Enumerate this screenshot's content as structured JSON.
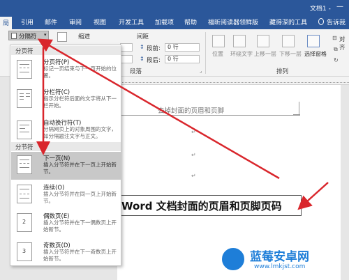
{
  "window": {
    "title": "文档1 -"
  },
  "tabs": [
    {
      "label": "局"
    },
    {
      "label": "引用"
    },
    {
      "label": "邮件"
    },
    {
      "label": "审阅"
    },
    {
      "label": "视图"
    },
    {
      "label": "开发工具"
    },
    {
      "label": "加载项"
    },
    {
      "label": "帮助"
    },
    {
      "label": "福昕阅读器领鲜版"
    },
    {
      "label": "藏得深的工具"
    },
    {
      "label": "告诉我"
    }
  ],
  "ribbon": {
    "breaks_button": "分隔符",
    "indent_label": "缩进",
    "spacing_label": "间距",
    "before_label": "段前:",
    "before_value": "0 行",
    "after_label": "段后:",
    "after_value": "0 行",
    "paragraph_group": "段落",
    "arrange_group": "排列",
    "arrange_buttons": [
      "位置",
      "环绕文字",
      "上移一层",
      "下移一层",
      "选择窗格"
    ],
    "align_label": "对齐"
  },
  "menu": {
    "page_breaks_header": "分页符",
    "section_breaks_header": "分节符",
    "items": [
      {
        "title": "分页符(P)",
        "desc": "标记一页结束与下一页开始的位置。"
      },
      {
        "title": "分栏符(C)",
        "desc": "指示分栏符后面的文字将从下一栏开始。"
      },
      {
        "title": "自动换行符(T)",
        "desc": "分隔网页上的对象周围的文字，如分隔题注文字与正文。"
      },
      {
        "title": "下一页(N)",
        "desc": "插入分节符并在下一页上开始新节。"
      },
      {
        "title": "连续(O)",
        "desc": "插入分节符并在同一页上开始新节。"
      },
      {
        "title": "偶数页(E)",
        "desc": "插入分节符并在下一偶数页上开始新节。"
      },
      {
        "title": "奇数页(D)",
        "desc": "插入分节符并在下一奇数页上开始新节。"
      }
    ]
  },
  "document": {
    "header_text": "去掉封面的页眉和页脚",
    "para_mark": "↵",
    "main_text": "Word 文档封面的页眉和页脚页码"
  },
  "watermark": {
    "brand": "蓝莓安卓网",
    "url": "www.lmkjst.com"
  },
  "colors": {
    "ribbon_blue": "#2b579a",
    "arrow_red": "#d9262c",
    "selected_item": "#c8c8c8"
  }
}
